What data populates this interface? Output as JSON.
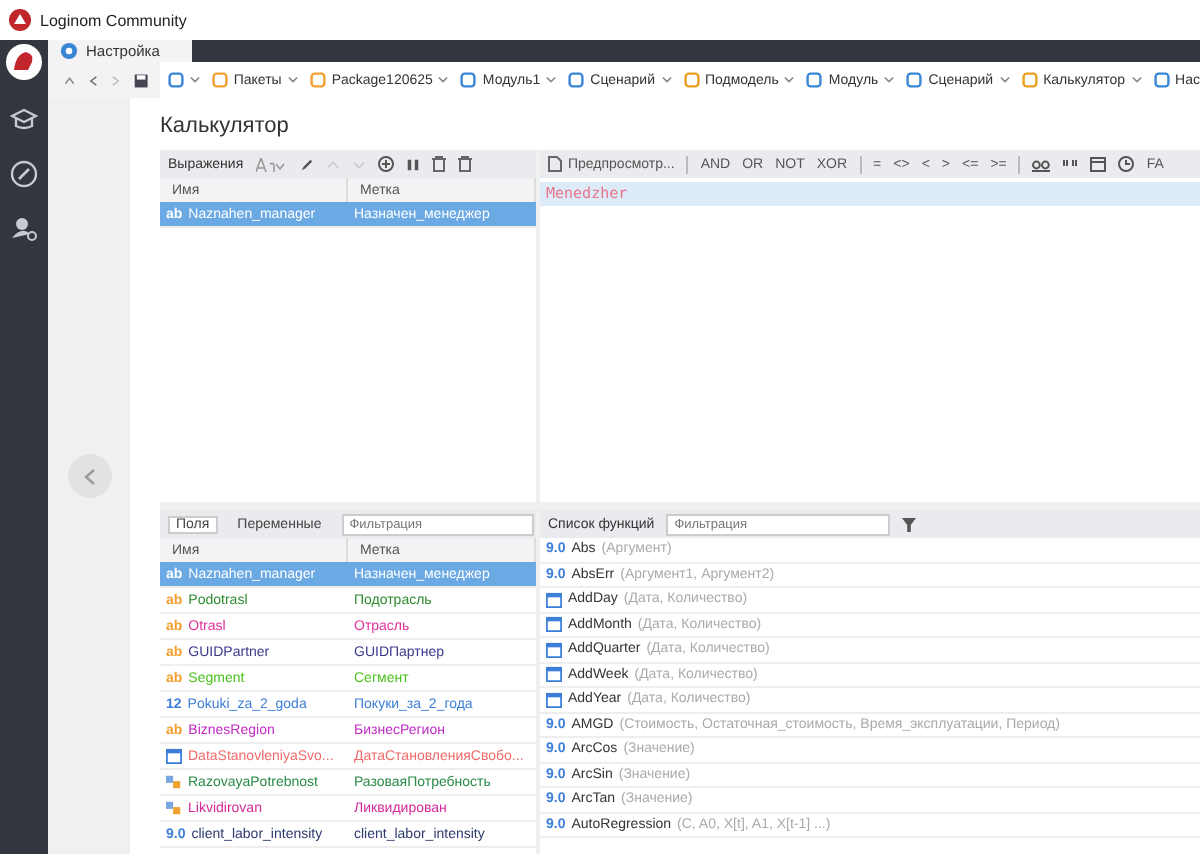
{
  "window": {
    "title": "Loginom Community"
  },
  "tabs": [
    {
      "label": "Настройка",
      "selected": true
    }
  ],
  "breadcrumbs": [
    {
      "kind": "tree"
    },
    {
      "label": "Пакеты",
      "kind": "package"
    },
    {
      "label": "Package120625",
      "kind": "package"
    },
    {
      "label": "Модуль1",
      "kind": "module"
    },
    {
      "label": "Сценарий",
      "kind": "scenario"
    },
    {
      "label": "Подмодель",
      "kind": "submodel"
    },
    {
      "label": "Модуль",
      "kind": "module"
    },
    {
      "label": "Сценарий",
      "kind": "scenario"
    },
    {
      "label": "Калькулятор",
      "kind": "calc"
    },
    {
      "label": "Нас",
      "kind": "settings"
    }
  ],
  "page_title": "Калькулятор",
  "expressions": {
    "label": "Выражения",
    "columns": [
      "Имя",
      "Метка"
    ],
    "rows": [
      {
        "type_label": "ab",
        "name": "Naznahen_manager",
        "label": "Назначен_менеджер",
        "selected": true
      }
    ]
  },
  "editor": {
    "preview": "Предпросмотр...",
    "operators": [
      "AND",
      "OR",
      "NOT",
      "XOR"
    ],
    "comparisons": [
      "=",
      "<>",
      "<",
      ">",
      "<=",
      ">="
    ],
    "more": "FA",
    "code": "Menedzher"
  },
  "fields": {
    "tabs": [
      {
        "label": "Поля",
        "selected": true
      },
      {
        "label": "Переменные",
        "selected": false
      }
    ],
    "placeholder": "Фильтрация",
    "columns": [
      "Имя",
      "Метка"
    ],
    "rows": [
      {
        "kind": "string",
        "type_label": "ab",
        "name": "Naznahen_manager",
        "label": "Назначен_менеджер",
        "color": "#ffffff",
        "selected": true
      },
      {
        "kind": "string",
        "type_label": "ab",
        "name": "Podotrasl",
        "label": "Подотрасль",
        "color": "#2e8b2e",
        "selected": false
      },
      {
        "kind": "string",
        "type_label": "ab",
        "name": "Otrasl",
        "label": "Отрасль",
        "color": "#e0329b",
        "selected": false
      },
      {
        "kind": "string",
        "type_label": "ab",
        "name": "GUIDPartner",
        "label": "GUIDПартнер",
        "color": "#3a3a8c",
        "selected": false
      },
      {
        "kind": "string",
        "type_label": "ab",
        "name": "Segment",
        "label": "Сегмент",
        "color": "#4cc21e",
        "selected": false
      },
      {
        "kind": "integer",
        "type_label": "12",
        "name": "Pokuki_za_2_goda",
        "label": "Покуки_за_2_года",
        "color": "#3d7fd6",
        "selected": false
      },
      {
        "kind": "string",
        "type_label": "ab",
        "name": "BiznesRegion",
        "label": "БизнесРегион",
        "color": "#c02bc4",
        "selected": false
      },
      {
        "kind": "date",
        "name": "DataStanovleniyaSvo...",
        "label": "ДатаСтановленияСвобо...",
        "color": "#f06a6a",
        "selected": false
      },
      {
        "kind": "bool",
        "name": "RazovayaPotrebnost",
        "label": "РазоваяПотребность",
        "color": "#2a8a48",
        "selected": false
      },
      {
        "kind": "bool",
        "name": "Likvidirovan",
        "label": "Ликвидирован",
        "color": "#d42a9a",
        "selected": false
      },
      {
        "kind": "float",
        "type_label": "9.0",
        "name": "client_labor_intensity",
        "label": "client_labor_intensity",
        "color": "#2d3a6e",
        "selected": false
      }
    ]
  },
  "functions": {
    "label": "Список функций",
    "placeholder": "Фильтрация",
    "rows": [
      {
        "kind": "float",
        "type_label": "9.0",
        "name": "Abs",
        "args": "(Аргумент)"
      },
      {
        "kind": "float",
        "type_label": "9.0",
        "name": "AbsErr",
        "args": "(Аргумент1, Аргумент2)"
      },
      {
        "kind": "date",
        "name": "AddDay",
        "args": "(Дата, Количество)"
      },
      {
        "kind": "date",
        "name": "AddMonth",
        "args": "(Дата, Количество)"
      },
      {
        "kind": "date",
        "name": "AddQuarter",
        "args": "(Дата, Количество)"
      },
      {
        "kind": "date",
        "name": "AddWeek",
        "args": "(Дата, Количество)"
      },
      {
        "kind": "date",
        "name": "AddYear",
        "args": "(Дата, Количество)"
      },
      {
        "kind": "float",
        "type_label": "9.0",
        "name": "AMGD",
        "args": "(Стоимость, Остаточная_стоимость, Время_эксплуатации, Период)"
      },
      {
        "kind": "float",
        "type_label": "9.0",
        "name": "ArcCos",
        "args": "(Значение)"
      },
      {
        "kind": "float",
        "type_label": "9.0",
        "name": "ArcSin",
        "args": "(Значение)"
      },
      {
        "kind": "float",
        "type_label": "9.0",
        "name": "ArcTan",
        "args": "(Значение)"
      },
      {
        "kind": "float",
        "type_label": "9.0",
        "name": "AutoRegression",
        "args": "(C, A0, X[t], A1, X[t-1] ...)"
      }
    ]
  }
}
